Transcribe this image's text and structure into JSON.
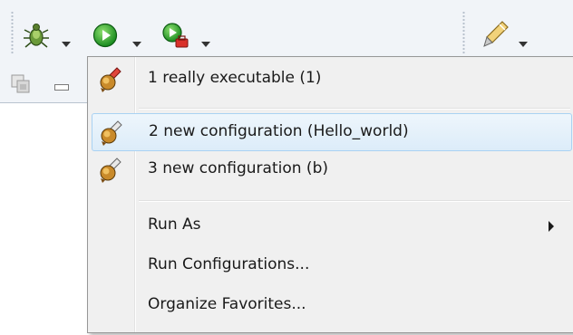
{
  "toolbar": {
    "icons": [
      "debug-bug-icon",
      "run-play-icon",
      "run-tool-icon",
      "pen-edit-icon"
    ]
  },
  "menu": {
    "favorites": [
      {
        "label": "1 really executable (1)",
        "icon": "launch-config-red-icon"
      },
      {
        "label": "2 new configuration (Hello_world)",
        "icon": "launch-config-icon",
        "highlighted": true
      },
      {
        "label": "3 new configuration (b)",
        "icon": "launch-config-icon"
      }
    ],
    "run_as": "Run As",
    "run_configurations": "Run Configurations...",
    "organize_favorites": "Organize Favorites..."
  },
  "colors": {
    "highlight_border": "#a9d2f3",
    "menu_bg": "#f0f0f0",
    "toolbar_bg": "#f1f4f8"
  }
}
